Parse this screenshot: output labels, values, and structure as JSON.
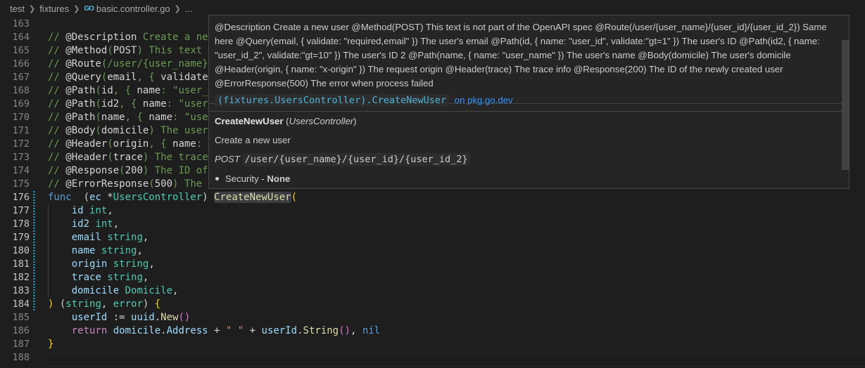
{
  "breadcrumb": {
    "items": [
      "test",
      "fixtures"
    ],
    "go_icon_label": "GO",
    "file": "basic.controller.go",
    "ellipsis": "..."
  },
  "lines": [
    {
      "n": "163",
      "tokens": []
    },
    {
      "n": "164",
      "tokens": [
        [
          "c-com",
          "// "
        ],
        [
          "c-tag",
          "@Description"
        ],
        [
          "c-com",
          " Create a new user"
        ]
      ]
    },
    {
      "n": "165",
      "tokens": [
        [
          "c-com",
          "// "
        ],
        [
          "c-tag",
          "@Method"
        ],
        [
          "c-com",
          "("
        ],
        [
          "c-tag",
          "POST"
        ],
        [
          "c-com",
          ") This text is not part of the OpenAPI spec"
        ]
      ]
    },
    {
      "n": "166",
      "tokens": [
        [
          "c-com",
          "// "
        ],
        [
          "c-tag",
          "@Route"
        ],
        [
          "c-com",
          "(/user/{user_name}/{user_id}/{user_id_2})"
        ]
      ]
    },
    {
      "n": "167",
      "tokens": [
        [
          "c-com",
          "// "
        ],
        [
          "c-tag",
          "@Query"
        ],
        [
          "c-com",
          "("
        ],
        [
          "c-tag",
          "email"
        ],
        [
          "c-com",
          ", { "
        ],
        [
          "c-tag",
          "validate"
        ],
        [
          "c-com",
          ": \"required,email\" })"
        ]
      ]
    },
    {
      "n": "168",
      "tokens": [
        [
          "c-com",
          "// "
        ],
        [
          "c-tag",
          "@Path"
        ],
        [
          "c-com",
          "("
        ],
        [
          "c-tag",
          "id"
        ],
        [
          "c-com",
          ", { "
        ],
        [
          "c-tag",
          "name"
        ],
        [
          "c-com",
          ": \"user_id\" })"
        ]
      ]
    },
    {
      "n": "169",
      "tokens": [
        [
          "c-com",
          "// "
        ],
        [
          "c-tag",
          "@Path"
        ],
        [
          "c-com",
          "("
        ],
        [
          "c-tag",
          "id2"
        ],
        [
          "c-com",
          ", { "
        ],
        [
          "c-tag",
          "name"
        ],
        [
          "c-com",
          ": \"user_id_2\" })"
        ]
      ]
    },
    {
      "n": "170",
      "tokens": [
        [
          "c-com",
          "// "
        ],
        [
          "c-tag",
          "@Path"
        ],
        [
          "c-com",
          "("
        ],
        [
          "c-tag",
          "name"
        ],
        [
          "c-com",
          ", { "
        ],
        [
          "c-tag",
          "name"
        ],
        [
          "c-com",
          ": \"user_name\" })"
        ]
      ]
    },
    {
      "n": "171",
      "tokens": [
        [
          "c-com",
          "// "
        ],
        [
          "c-tag",
          "@Body"
        ],
        [
          "c-com",
          "("
        ],
        [
          "c-tag",
          "domicile"
        ],
        [
          "c-com",
          ") The user's domicile"
        ]
      ]
    },
    {
      "n": "172",
      "tokens": [
        [
          "c-com",
          "// "
        ],
        [
          "c-tag",
          "@Header"
        ],
        [
          "c-com",
          "("
        ],
        [
          "c-tag",
          "origin"
        ],
        [
          "c-com",
          ", { "
        ],
        [
          "c-tag",
          "name"
        ],
        [
          "c-com",
          ": \"x-origin\" })"
        ]
      ]
    },
    {
      "n": "173",
      "tokens": [
        [
          "c-com",
          "// "
        ],
        [
          "c-tag",
          "@Header"
        ],
        [
          "c-com",
          "("
        ],
        [
          "c-tag",
          "trace"
        ],
        [
          "c-com",
          ") The trace info"
        ]
      ]
    },
    {
      "n": "174",
      "tokens": [
        [
          "c-com",
          "// "
        ],
        [
          "c-tag",
          "@Response"
        ],
        [
          "c-com",
          "("
        ],
        [
          "c-tag",
          "200"
        ],
        [
          "c-com",
          ") The ID of the newly created user"
        ]
      ]
    },
    {
      "n": "175",
      "tokens": [
        [
          "c-com",
          "// "
        ],
        [
          "c-tag",
          "@ErrorResponse"
        ],
        [
          "c-com",
          "("
        ],
        [
          "c-tag",
          "500"
        ],
        [
          "c-com",
          ") The error when process failed"
        ]
      ]
    },
    {
      "n": "176",
      "tokens": [
        [
          "c-kw",
          "func"
        ],
        [
          "",
          "  ("
        ],
        [
          "c-var",
          "ec"
        ],
        [
          "",
          " *"
        ],
        [
          "c-type",
          "UsersController"
        ],
        [
          "",
          ") "
        ],
        [
          "c-fn hl-word",
          "CreateNewUser"
        ],
        [
          "c-brace",
          "("
        ]
      ]
    },
    {
      "n": "177",
      "tokens": [
        [
          "",
          "    "
        ],
        [
          "c-var",
          "id"
        ],
        [
          "",
          " "
        ],
        [
          "c-type",
          "int"
        ],
        [
          "",
          ","
        ]
      ]
    },
    {
      "n": "178",
      "tokens": [
        [
          "",
          "    "
        ],
        [
          "c-var",
          "id2"
        ],
        [
          "",
          " "
        ],
        [
          "c-type",
          "int"
        ],
        [
          "",
          ","
        ]
      ]
    },
    {
      "n": "179",
      "tokens": [
        [
          "",
          "    "
        ],
        [
          "c-var",
          "email"
        ],
        [
          "",
          " "
        ],
        [
          "c-type",
          "string"
        ],
        [
          "",
          ","
        ]
      ]
    },
    {
      "n": "180",
      "tokens": [
        [
          "",
          "    "
        ],
        [
          "c-var",
          "name"
        ],
        [
          "",
          " "
        ],
        [
          "c-type",
          "string"
        ],
        [
          "",
          ","
        ]
      ]
    },
    {
      "n": "181",
      "tokens": [
        [
          "",
          "    "
        ],
        [
          "c-var",
          "origin"
        ],
        [
          "",
          " "
        ],
        [
          "c-type",
          "string"
        ],
        [
          "",
          ","
        ]
      ]
    },
    {
      "n": "182",
      "tokens": [
        [
          "",
          "    "
        ],
        [
          "c-var",
          "trace"
        ],
        [
          "",
          " "
        ],
        [
          "c-type",
          "string"
        ],
        [
          "",
          ","
        ]
      ]
    },
    {
      "n": "183",
      "tokens": [
        [
          "",
          "    "
        ],
        [
          "c-var",
          "domicile"
        ],
        [
          "",
          " "
        ],
        [
          "c-type",
          "Domicile"
        ],
        [
          "",
          ","
        ]
      ]
    },
    {
      "n": "184",
      "tokens": [
        [
          "c-brace",
          ")"
        ],
        [
          "",
          " ("
        ],
        [
          "c-type",
          "string"
        ],
        [
          "",
          ", "
        ],
        [
          "c-type",
          "error"
        ],
        [
          "",
          ") "
        ],
        [
          "c-brace",
          "{"
        ]
      ]
    },
    {
      "n": "185",
      "tokens": [
        [
          "",
          "    "
        ],
        [
          "c-var",
          "userId"
        ],
        [
          "",
          " := "
        ],
        [
          "c-var",
          "uuid"
        ],
        [
          "",
          "."
        ],
        [
          "c-fn",
          "New"
        ],
        [
          "c-paren",
          "()"
        ]
      ]
    },
    {
      "n": "186",
      "tokens": [
        [
          "",
          "    "
        ],
        [
          "c-ctl",
          "return"
        ],
        [
          "",
          " "
        ],
        [
          "c-var",
          "domicile"
        ],
        [
          "",
          "."
        ],
        [
          "c-var",
          "Address"
        ],
        [
          "",
          " + "
        ],
        [
          "c-str",
          "\" \""
        ],
        [
          "",
          " + "
        ],
        [
          "c-var",
          "userId"
        ],
        [
          "",
          "."
        ],
        [
          "c-fn",
          "String"
        ],
        [
          "c-paren",
          "()"
        ],
        [
          "",
          ", "
        ],
        [
          "c-nil",
          "nil"
        ]
      ]
    },
    {
      "n": "187",
      "tokens": [
        [
          "c-brace",
          "}"
        ]
      ]
    },
    {
      "n": "188",
      "tokens": []
    }
  ],
  "hover": {
    "description": "@Description Create a new user @Method(POST) This text is not part of the OpenAPI spec @Route(/user/{user_name}/{user_id}/{user_id_2}) Same here @Query(email, { validate: \"required,email\" }) The user's email @Path(id, { name: \"user_id\", validate:\"gt=1\" }) The user's ID @Path(id2, { name: \"user_id_2\", validate:\"gt=10\" }) The user's ID 2 @Path(name, { name: \"user_name\" }) The user's name @Body(domicile) The user's domicile @Header(origin, { name: \"x-origin\" }) The request origin @Header(trace) The trace info @Response(200) The ID of the newly created user @ErrorResponse(500) The error when process failed",
    "signature": "(fixtures.UsersController).CreateNewUser",
    "pkg_link": "on pkg.go.dev",
    "title_name": "CreateNewUser",
    "title_receiver": "UsersController",
    "summary": "Create a new user",
    "method": "POST",
    "route": "/user/{user_name}/{user_id}/{user_id_2}",
    "security_label": "Security - ",
    "security_value": "None"
  }
}
